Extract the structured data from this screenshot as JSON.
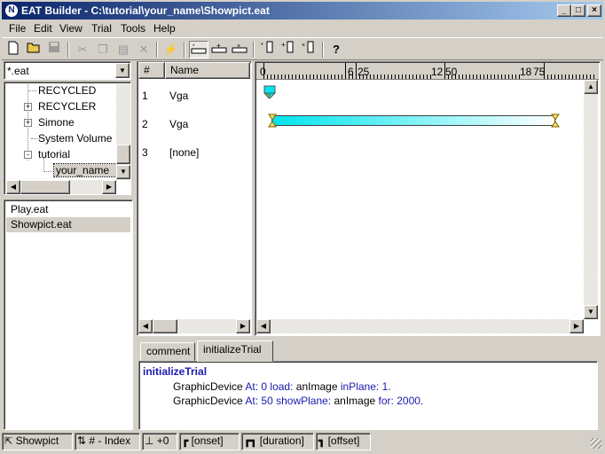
{
  "window": {
    "title": "EAT Builder - C:\\tutorial\\your_name\\Showpict.eat",
    "app_icon": "N"
  },
  "menu": [
    "File",
    "Edit",
    "View",
    "Trial",
    "Tools",
    "Help"
  ],
  "toolbar": {
    "icons": [
      "new-icon",
      "open-icon",
      "save-icon",
      "cut-icon",
      "copy-icon",
      "paste-icon",
      "delete-icon",
      "run-icon",
      "insert-first-icon",
      "insert-icon",
      "remove-icon",
      "add-trial-before-icon",
      "add-trial-icon",
      "remove-trial-icon",
      "help-icon"
    ],
    "help_label": "?"
  },
  "filter": {
    "value": "*.eat"
  },
  "tree": {
    "items": [
      {
        "label": "RECYCLED",
        "expander": ""
      },
      {
        "label": "RECYCLER",
        "expander": "+"
      },
      {
        "label": "Simone",
        "expander": "+"
      },
      {
        "label": "System Volume",
        "expander": ""
      },
      {
        "label": "tutorial",
        "expander": "-"
      },
      {
        "label": "your_name",
        "expander": ""
      }
    ]
  },
  "files": [
    {
      "label": "Play.eat",
      "selected": false
    },
    {
      "label": "Showpict.eat",
      "selected": true
    }
  ],
  "trials": {
    "columns": [
      "#",
      "Name"
    ],
    "rows": [
      {
        "index": "1",
        "name": "Vga"
      },
      {
        "index": "2",
        "name": "Vga"
      },
      {
        "index": "3",
        "name": "[none]"
      }
    ]
  },
  "timeline": {
    "ruler_labels": [
      "0",
      "6",
      "25",
      "12",
      "50",
      "18",
      "75"
    ],
    "bar_color": "#00e5ee"
  },
  "tabs": [
    {
      "label": "comment",
      "active": false
    },
    {
      "label": "initializeTrial",
      "active": true
    }
  ],
  "code": {
    "header": "initializeTrial",
    "line1": {
      "obj": "GraphicDevice",
      "k1": "At:",
      "n1": "0",
      "k2": "load:",
      "arg": "anImage",
      "k3": "inPlane:",
      "n2": "1."
    },
    "line2": {
      "obj": "GraphicDevice",
      "k1": "At:",
      "n1": "50",
      "k2": "showPlane:",
      "arg": "anImage",
      "k3": "for:",
      "n2": "2000."
    }
  },
  "status": {
    "file": "Showpict",
    "index": "# - Index",
    "offset": "+0",
    "onset": "[onset]",
    "duration": "[duration]",
    "offset_label": "[offset]"
  }
}
